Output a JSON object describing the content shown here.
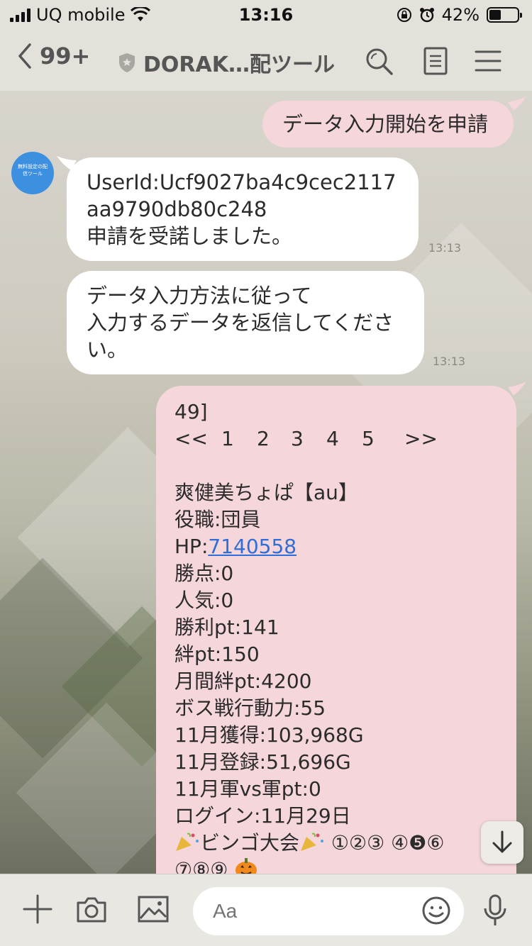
{
  "status": {
    "carrier": "UQ mobile",
    "time": "13:16",
    "battery": "42%",
    "battery_level": 0.42
  },
  "header": {
    "back_count": "99+",
    "title": "DORAK…配ツール"
  },
  "messages": {
    "request": "データ入力開始を申請",
    "reply1_line1": "UserId:Ucf9027ba4c9cec2117",
    "reply1_line2": "aa9790db80c248",
    "reply1_line3": "申請を受諾しました。",
    "reply1_time": "13:13",
    "reply2_line1": "データ入力方法に従って",
    "reply2_line2": "入力するデータを返信してくださ",
    "reply2_line3": "い。",
    "reply2_time": "13:13",
    "avatar_text_line1": "無料設定の配",
    "avatar_text_line2": "信ツール"
  },
  "data_message": {
    "line1": "49]",
    "pager": [
      "<<",
      "1",
      "2",
      "3",
      "4",
      "5",
      ">>"
    ],
    "name": "爽健美ちょぱ【au】",
    "role": "役職:団員",
    "hp_label": "HP:",
    "hp_value": "7140558",
    "wins": "勝点:0",
    "popularity": "人気:0",
    "victory_pt": "勝利pt:141",
    "bond_pt": "絆pt:150",
    "monthly_bond_pt": "月間絆pt:4200",
    "boss_action": "ボス戦行動力:55",
    "nov_acquired": "11月獲得:103,968G",
    "nov_registered": "11月登録:51,696G",
    "nov_army_pt": "11月軍vs軍pt:0",
    "login": "ログイン:11月29日",
    "bingo_label": "ビンゴ大会",
    "bingo_nums": "①②③ ④❺⑥",
    "bingo_nums2": "⑦⑧⑨"
  },
  "input": {
    "placeholder": "Aa"
  }
}
